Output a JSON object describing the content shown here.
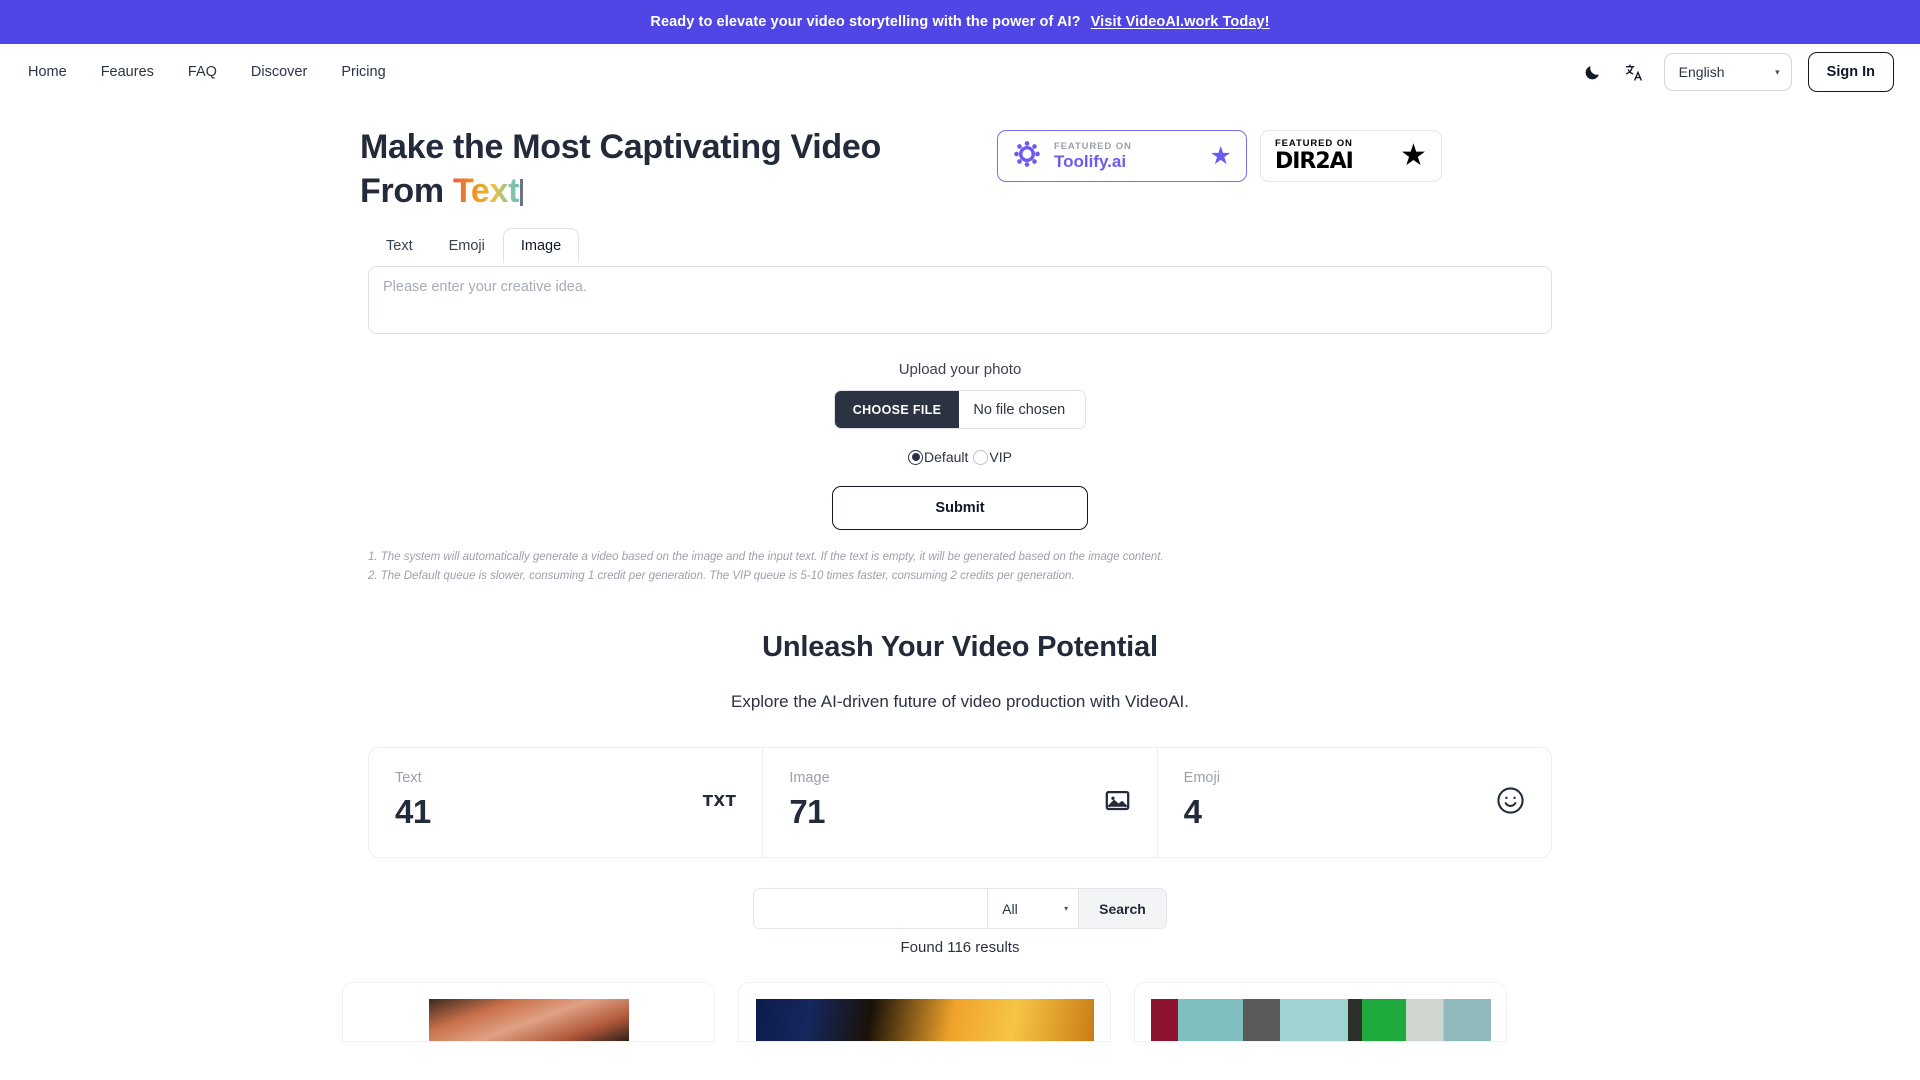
{
  "banner": {
    "text": "Ready to elevate your video storytelling with the power of AI?",
    "link_label": "Visit VideoAI.work Today!",
    "background_color": "#4f46e5"
  },
  "nav": {
    "links": [
      {
        "label": "Home"
      },
      {
        "label": "Feaures"
      },
      {
        "label": "FAQ"
      },
      {
        "label": "Discover"
      },
      {
        "label": "Pricing"
      }
    ],
    "dark_mode_icon": "moon-icon",
    "translate_icon": "translate-icon",
    "language": {
      "selected": "English",
      "caret": "▾"
    },
    "sign_in_label": "Sign In"
  },
  "hero": {
    "title_line1": "Make the Most Captivating Video",
    "title_line2_prefix": "From ",
    "title_line2_gradient": "Text",
    "badges": [
      {
        "featured_label": "FEATURED ON",
        "name": "Toolify.ai",
        "star": "★",
        "accent": "#6d5bef"
      },
      {
        "featured_label": "FEATURED ON",
        "name": "DIR2AI",
        "star": "★",
        "accent": "#000000"
      }
    ]
  },
  "generator": {
    "tabs": [
      {
        "label": "Text",
        "active": false
      },
      {
        "label": "Emoji",
        "active": false
      },
      {
        "label": "Image",
        "active": true
      }
    ],
    "idea_placeholder": "Please enter your creative idea.",
    "idea_value": "",
    "upload_label": "Upload your photo",
    "choose_file_label": "CHOOSE FILE",
    "no_file_label": "No file chosen",
    "queue_options": [
      {
        "label": "Default",
        "checked": true
      },
      {
        "label": "VIP",
        "checked": false
      }
    ],
    "submit_label": "Submit",
    "notes": [
      "1. The system will automatically generate a video based on the image and the input text. If the text is empty, it will be generated based on the image content.",
      "2. The Default queue is slower, consuming 1 credit per generation. The VIP queue is 5-10 times faster, consuming 2 credits per generation."
    ]
  },
  "potential": {
    "heading": "Unleash Your Video Potential",
    "subheading": "Explore the AI-driven future of video production with VideoAI."
  },
  "stats": [
    {
      "label": "Text",
      "value": "41",
      "icon": "txt-icon"
    },
    {
      "label": "Image",
      "value": "71",
      "icon": "picture-icon"
    },
    {
      "label": "Emoji",
      "value": "4",
      "icon": "smiley-icon"
    }
  ],
  "search": {
    "input_value": "",
    "filter_selected": "All",
    "filter_caret": "▾",
    "button_label": "Search",
    "results_text": "Found 116 results"
  },
  "gallery": {
    "cards": [
      {
        "name": "gallery-card-1"
      },
      {
        "name": "gallery-card-2"
      },
      {
        "name": "gallery-card-3"
      }
    ]
  }
}
